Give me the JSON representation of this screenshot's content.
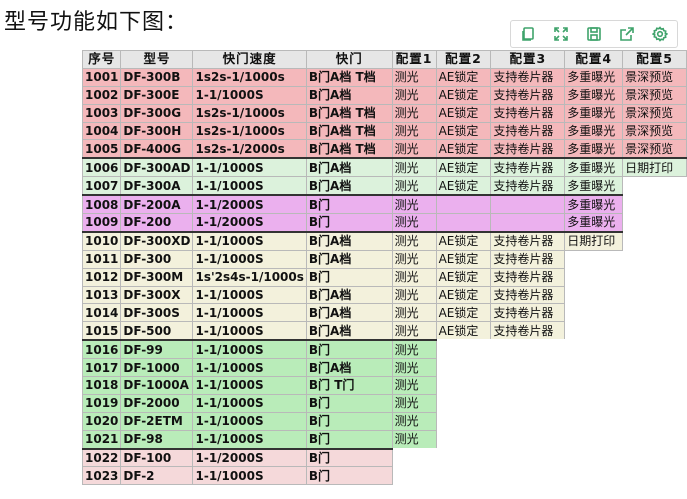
{
  "heading": "型号功能如下图：",
  "toolbar": {
    "icons": [
      "copy-icon",
      "fullscreen-icon",
      "save-icon",
      "share-icon",
      "settings-icon"
    ]
  },
  "table": {
    "headers": [
      "序号",
      "型号",
      "快门速度",
      "快门",
      "配置1",
      "配置2",
      "配置3",
      "配置4",
      "配置5"
    ],
    "groups": [
      {
        "color": "pink",
        "rows": [
          [
            "1001",
            "DF-300B",
            "1s2s-1/1000s",
            "B门A档  T档",
            "测光",
            "AE锁定",
            "支持卷片器",
            "多重曝光",
            "景深预览"
          ],
          [
            "1002",
            "DF-300E",
            "1-1/1000S",
            "B门A档",
            "测光",
            "AE锁定",
            "支持卷片器",
            "多重曝光",
            "景深预览"
          ],
          [
            "1003",
            "DF-300G",
            "1s2s-1/1000s",
            "B门A档  T档",
            "测光",
            "AE锁定",
            "支持卷片器",
            "多重曝光",
            "景深预览"
          ],
          [
            "1004",
            "DF-300H",
            "1s2s-1/1000s",
            "B门A档  T档",
            "测光",
            "AE锁定",
            "支持卷片器",
            "多重曝光",
            "景深预览"
          ],
          [
            "1005",
            "DF-400G",
            "1s2s-1/2000s",
            "B门A档  T档",
            "测光",
            "AE锁定",
            "支持卷片器",
            "多重曝光",
            "景深预览"
          ]
        ]
      },
      {
        "color": "green",
        "rows": [
          [
            "1006",
            "DF-300AD",
            "1-1/1000S",
            "B门A档",
            "测光",
            "AE锁定",
            "支持卷片器",
            "多重曝光",
            "日期打印"
          ],
          [
            "1007",
            "DF-300A",
            "1-1/1000S",
            "B门A档",
            "测光",
            "AE锁定",
            "支持卷片器",
            "多重曝光",
            ""
          ]
        ]
      },
      {
        "color": "magenta",
        "rows": [
          [
            "1008",
            "DF-200A",
            "1-1/2000S",
            "B门",
            "测光",
            "",
            "",
            "多重曝光",
            ""
          ],
          [
            "1009",
            "DF-200",
            "1-1/2000S",
            "B门",
            "测光",
            "",
            "",
            "多重曝光",
            ""
          ]
        ]
      },
      {
        "color": "beige",
        "rows": [
          [
            "1010",
            "DF-300XD",
            "1-1/1000S",
            "B门A档",
            "测光",
            "AE锁定",
            "支持卷片器",
            "日期打印",
            ""
          ],
          [
            "1011",
            "DF-300",
            "1-1/1000S",
            "B门A档",
            "测光",
            "AE锁定",
            "支持卷片器",
            "",
            ""
          ],
          [
            "1012",
            "DF-300M",
            "1s'2s4s-1/1000s",
            "B门",
            "测光",
            "AE锁定",
            "支持卷片器",
            "",
            ""
          ],
          [
            "1013",
            "DF-300X",
            "1-1/1000S",
            "B门A档",
            "测光",
            "AE锁定",
            "支持卷片器",
            "",
            ""
          ],
          [
            "1014",
            "DF-300S",
            "1-1/1000S",
            "B门A档",
            "测光",
            "AE锁定",
            "支持卷片器",
            "",
            ""
          ],
          [
            "1015",
            "DF-500",
            "1-1/1000S",
            "B门A档",
            "测光",
            "AE锁定",
            "支持卷片器",
            "",
            ""
          ]
        ]
      },
      {
        "color": "lg",
        "rows": [
          [
            "1016",
            "DF-99",
            "1-1/1000S",
            "B门",
            "测光",
            "",
            "",
            "",
            ""
          ],
          [
            "1017",
            "DF-1000",
            "1-1/1000S",
            "B门A档",
            "测光",
            "",
            "",
            "",
            ""
          ],
          [
            "1018",
            "DF-1000A",
            "1-1/1000S",
            "B门  T门",
            "测光",
            "",
            "",
            "",
            ""
          ],
          [
            "1019",
            "DF-2000",
            "1-1/1000S",
            "B门",
            "测光",
            "",
            "",
            "",
            ""
          ],
          [
            "1020",
            "DF-2ETM",
            "1-1/1000S",
            "B门",
            "测光",
            "",
            "",
            "",
            ""
          ],
          [
            "1021",
            "DF-98",
            "1-1/1000S",
            "B门",
            "测光",
            "",
            "",
            "",
            ""
          ]
        ]
      },
      {
        "color": "lp",
        "rows": [
          [
            "1022",
            "DF-100",
            "1-1/2000S",
            "B门",
            "",
            "",
            "",
            "",
            ""
          ],
          [
            "1023",
            "DF-2",
            "1-1/1000S",
            "B门",
            "",
            "",
            "",
            "",
            ""
          ]
        ]
      }
    ]
  }
}
